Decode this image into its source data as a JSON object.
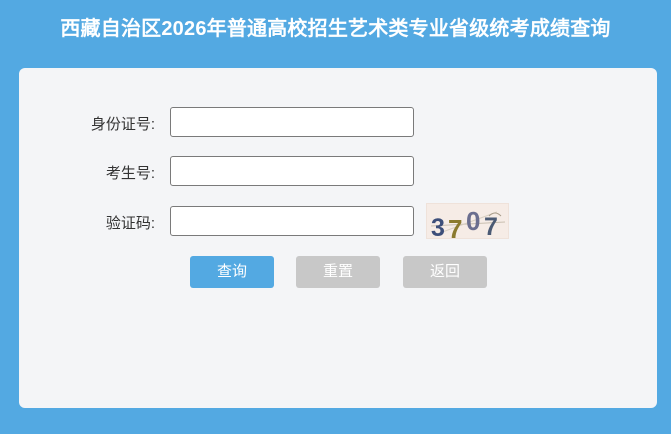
{
  "page": {
    "title": "西藏自治区2026年普通高校招生艺术类专业省级统考成绩查询"
  },
  "form": {
    "id_label": "身份证号:",
    "id_value": "",
    "exam_label": "考生号:",
    "exam_value": "",
    "code_label": "验证码:",
    "code_value": "",
    "captcha_text": "3707"
  },
  "buttons": {
    "query": "查询",
    "reset": "重置",
    "back": "返回"
  },
  "colors": {
    "background": "#53a9e2",
    "card": "#f4f5f7",
    "primary_button": "#53a9e2",
    "disabled_button": "#c8c8c8"
  }
}
